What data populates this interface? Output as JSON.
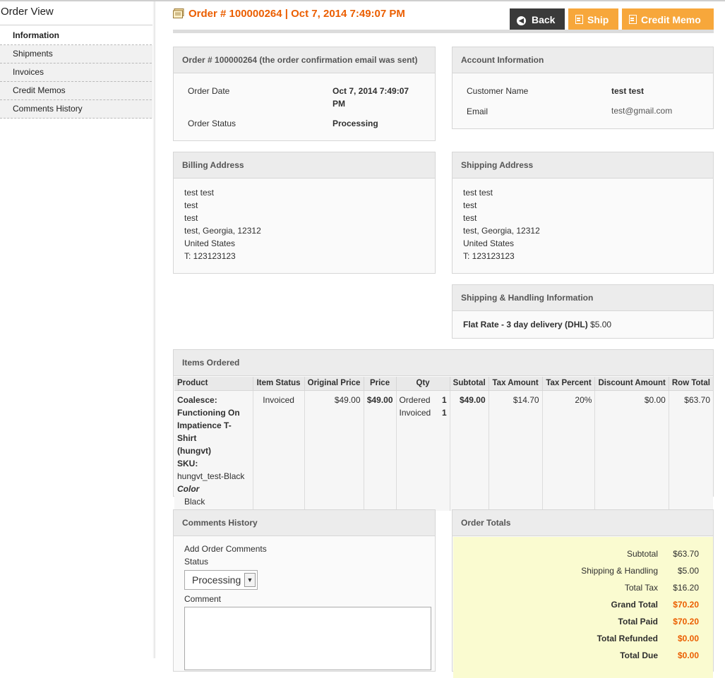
{
  "sidebar": {
    "title": "Order View",
    "items": [
      {
        "label": "Information",
        "active": true
      },
      {
        "label": "Shipments"
      },
      {
        "label": "Invoices"
      },
      {
        "label": "Credit Memos"
      },
      {
        "label": "Comments History"
      }
    ]
  },
  "header": {
    "title": "Order # 100000264 | Oct 7, 2014 7:49:07 PM",
    "back_label": "Back",
    "ship_label": "Ship",
    "credit_memo_label": "Credit Memo"
  },
  "order_box": {
    "title": "Order # 100000264 (the order confirmation email was sent)",
    "date_label": "Order Date",
    "date_value_line1": "Oct 7, 2014 7:49:07",
    "date_value_line2": "PM",
    "status_label": "Order Status",
    "status_value": "Processing"
  },
  "account_box": {
    "title": "Account Information",
    "name_label": "Customer Name",
    "name_value": "test test",
    "email_label": "Email",
    "email_value": "test@gmail.com"
  },
  "billing": {
    "title": "Billing Address",
    "lines": [
      "test test",
      "test",
      "test",
      "test, Georgia, 12312",
      "United States",
      "T: 123123123"
    ]
  },
  "shipping": {
    "title": "Shipping Address",
    "lines": [
      "test test",
      "test",
      "test",
      "test, Georgia, 12312",
      "United States",
      "T: 123123123"
    ]
  },
  "shipping_handling": {
    "title": "Shipping & Handling Information",
    "method": "Flat Rate - 3 day delivery (DHL)",
    "price": "$5.00"
  },
  "items": {
    "title": "Items Ordered",
    "columns": [
      "Product",
      "Item Status",
      "Original Price",
      "Price",
      "Qty",
      "Subtotal",
      "Tax Amount",
      "Tax Percent",
      "Discount Amount",
      "Row Total"
    ],
    "row": {
      "product_lines": [
        "Coalesce:",
        "Functioning On",
        "Impatience T-Shirt",
        "(hungvt)"
      ],
      "sku_label": "SKU:",
      "sku_value": "hungvt_test-Black",
      "option_label": "Color",
      "option_value": "Black",
      "item_status": "Invoiced",
      "original_price": "$49.00",
      "price": "$49.00",
      "qty_ordered_label": "Ordered",
      "qty_ordered": "1",
      "qty_invoiced_label": "Invoiced",
      "qty_invoiced": "1",
      "subtotal": "$49.00",
      "tax_amount": "$14.70",
      "tax_percent": "20%",
      "discount_amount": "$0.00",
      "row_total": "$63.70"
    }
  },
  "comments": {
    "title": "Comments History",
    "add_label": "Add Order Comments",
    "status_label": "Status",
    "status_value": "Processing",
    "comment_label": "Comment"
  },
  "totals": {
    "title": "Order Totals",
    "subtotal_label": "Subtotal",
    "subtotal_value": "$63.70",
    "shipping_label": "Shipping & Handling",
    "shipping_value": "$5.00",
    "tax_label": "Total Tax",
    "tax_value": "$16.20",
    "grand_label": "Grand Total",
    "grand_value": "$70.20",
    "paid_label": "Total Paid",
    "paid_value": "$70.20",
    "refunded_label": "Total Refunded",
    "refunded_value": "$0.00",
    "due_label": "Total Due",
    "due_value": "$0.00"
  },
  "colors": {
    "accent": "#eb5e00",
    "button_orange": "#f7a73b",
    "button_dark": "#3a3a3a",
    "totals_bg": "#fafbd0"
  }
}
